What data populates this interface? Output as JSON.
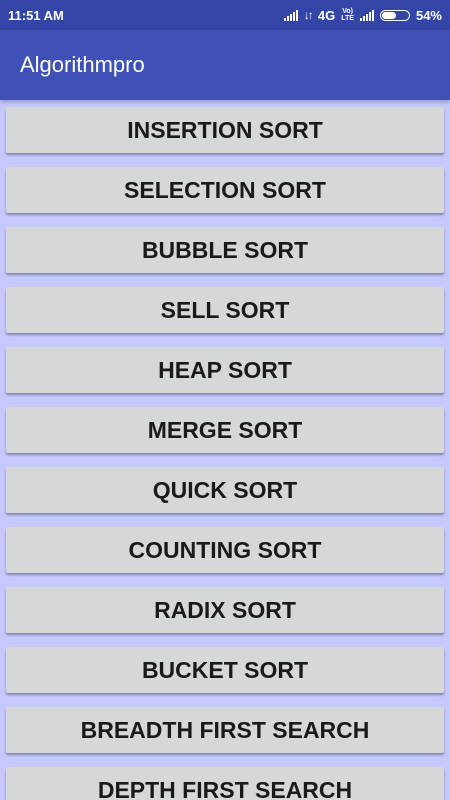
{
  "status_bar": {
    "time": "11:51 AM",
    "network_type": "4G",
    "volte_top": "Vo)",
    "volte_bottom": "LTE",
    "battery_text": "54%",
    "battery_level": 0.54
  },
  "app_bar": {
    "title": "Algorithmpro"
  },
  "buttons": [
    "INSERTION SORT",
    "SELECTION SORT",
    "BUBBLE SORT",
    "SELL SORT",
    "HEAP SORT",
    "MERGE SORT",
    "QUICK SORT",
    "COUNTING SORT",
    "RADIX SORT",
    "BUCKET SORT",
    "BREADTH FIRST SEARCH",
    "DEPTH FIRST SEARCH"
  ],
  "colors": {
    "status_bar": "#3346a8",
    "app_bar": "#3f51b5",
    "background": "#c5c9ff",
    "button": "#d6d7d7"
  }
}
